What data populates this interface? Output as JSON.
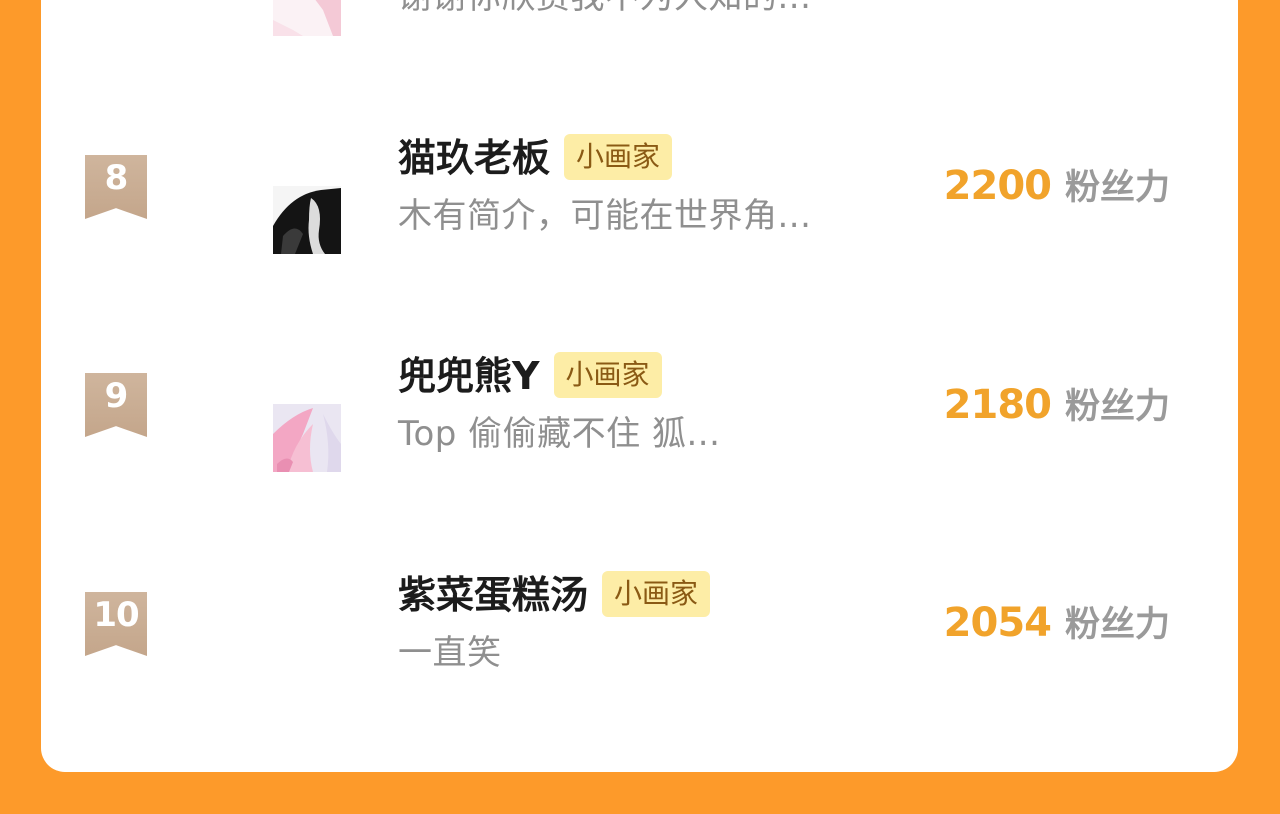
{
  "partial_top": {
    "bio": "谢谢你欣赏我不为人知的..."
  },
  "rows": [
    {
      "rank": "8",
      "name": "猫玖老板",
      "tag": "小画家",
      "bio": "木有简介，可能在世界角...",
      "fans": "2200",
      "fans_unit": "粉丝力"
    },
    {
      "rank": "9",
      "name": "兜兜熊Y",
      "tag": "小画家",
      "bio": "Top 偷偷藏不住 狐...",
      "fans": "2180",
      "fans_unit": "粉丝力"
    },
    {
      "rank": "10",
      "name": "紫菜蛋糕汤",
      "tag": "小画家",
      "bio": "一直笑",
      "fans": "2054",
      "fans_unit": "粉丝力"
    }
  ],
  "colors": {
    "background": "#fd9a2a",
    "card": "#ffffff",
    "fans_number": "#f1a32b",
    "tag_bg": "#fdeda6",
    "rank_badge": "#c9ad93"
  }
}
